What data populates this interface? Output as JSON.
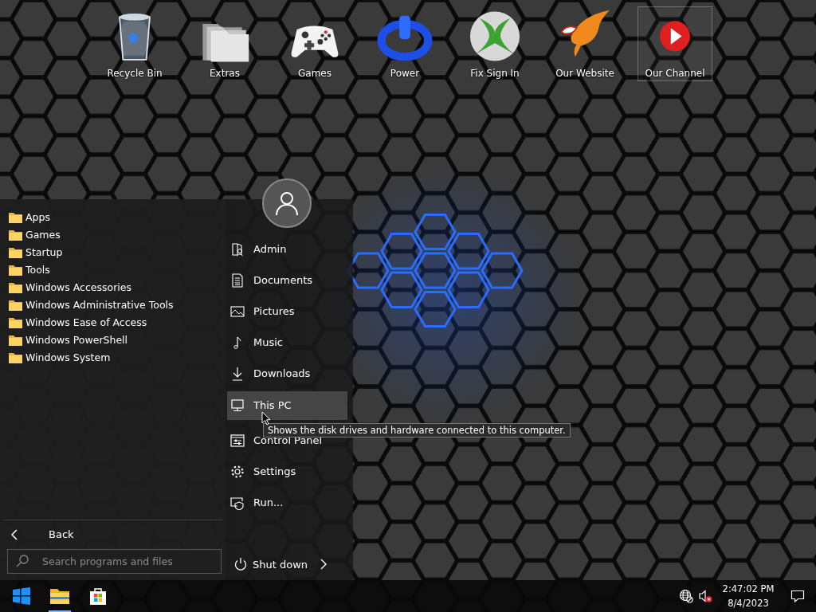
{
  "desktop_icons": [
    {
      "kind": "recycle-bin",
      "label": "Recycle Bin",
      "selected": false
    },
    {
      "kind": "folders",
      "label": "Extras",
      "selected": false
    },
    {
      "kind": "gamepad",
      "label": "Games",
      "selected": false
    },
    {
      "kind": "power",
      "label": "Power",
      "selected": false
    },
    {
      "kind": "x-ball",
      "label": "Fix Sign In",
      "selected": false
    },
    {
      "kind": "bird",
      "label": "Our Website",
      "selected": false
    },
    {
      "kind": "play",
      "label": "Our Channel",
      "selected": true
    }
  ],
  "start_menu": {
    "folders": [
      {
        "label": "Apps"
      },
      {
        "label": "Games"
      },
      {
        "label": "Startup"
      },
      {
        "label": "Tools"
      },
      {
        "label": "Windows Accessories"
      },
      {
        "label": "Windows Administrative Tools"
      },
      {
        "label": "Windows Ease of Access"
      },
      {
        "label": "Windows PowerShell"
      },
      {
        "label": "Windows System"
      }
    ],
    "back": {
      "label": "Back"
    },
    "search": {
      "placeholder": "Search programs and files"
    },
    "places": [
      {
        "kind": "user",
        "label": "Admin",
        "selected": false
      },
      {
        "kind": "document",
        "label": "Documents",
        "selected": false
      },
      {
        "kind": "picture",
        "label": "Pictures",
        "selected": false
      },
      {
        "kind": "music",
        "label": "Music",
        "selected": false
      },
      {
        "kind": "download",
        "label": "Downloads",
        "selected": false
      },
      {
        "kind": "pc",
        "label": "This PC",
        "selected": true
      },
      {
        "kind": "control",
        "label": "Control Panel",
        "selected": false
      },
      {
        "kind": "settings",
        "label": "Settings",
        "selected": false
      },
      {
        "kind": "run",
        "label": "Run...",
        "selected": false
      }
    ],
    "shutdown": {
      "label": "Shut down"
    },
    "tooltip": {
      "text": "Shows the disk drives and hardware connected to this computer."
    }
  },
  "taskbar": {
    "apps": [
      {
        "kind": "start",
        "running": false
      },
      {
        "kind": "explorer",
        "running": true
      },
      {
        "kind": "store",
        "running": false
      }
    ],
    "clock": {
      "time": "2:47:02 PM",
      "date": "8/4/2023"
    }
  }
}
